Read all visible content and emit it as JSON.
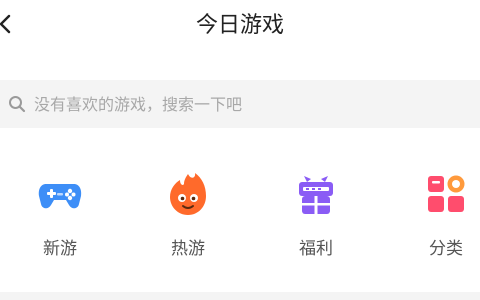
{
  "header": {
    "title": "今日游戏",
    "back_icon": "chevron-left-icon"
  },
  "search": {
    "placeholder": "没有喜欢的游戏，搜索一下吧",
    "value": "",
    "icon": "search-icon"
  },
  "categories": [
    {
      "label": "新游",
      "icon": "gamepad-icon",
      "color": "#3d8ef7"
    },
    {
      "label": "热游",
      "icon": "flame-icon",
      "color": "#ff6a2b"
    },
    {
      "label": "福利",
      "icon": "gift-box-icon",
      "color": "#8a5cf5"
    },
    {
      "label": "分类",
      "icon": "grid-category-icon",
      "color": "#ff4d6d"
    }
  ]
}
